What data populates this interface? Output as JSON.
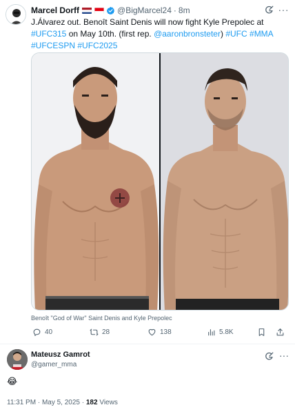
{
  "tweet": {
    "author_name": "Marcel Dorff",
    "handle": "@BigMarcel24",
    "separator": "·",
    "time": "8m",
    "text_parts": [
      {
        "t": "J.Álvarez out. Benoît Saint Denis will now fight Kyle Prepolec at ",
        "link": false
      },
      {
        "t": "#UFC315",
        "link": true
      },
      {
        "t": " on May 10th. (first rep. ",
        "link": false
      },
      {
        "t": "@aaronbronsteter",
        "link": true
      },
      {
        "t": ") ",
        "link": false
      },
      {
        "t": "#UFC",
        "link": true
      },
      {
        "t": " ",
        "link": false
      },
      {
        "t": "#MMA",
        "link": true
      },
      {
        "t": " ",
        "link": false
      },
      {
        "t": "#UFCESPN",
        "link": true
      },
      {
        "t": " ",
        "link": false
      },
      {
        "t": "#UFC2025",
        "link": true
      }
    ],
    "media_caption": "Benoît \"God of War\" Saint Denis and Kyle Prepolec",
    "actions": {
      "replies": "40",
      "reposts": "28",
      "likes": "138",
      "views": "5.8K"
    }
  },
  "reply": {
    "author_name": "Mateusz Gamrot",
    "handle": "@gamer_mma",
    "emoji": "😂",
    "timestamp": "11:31 PM · May 5, 2025 · ",
    "views_count": "182",
    "views_label": " Views"
  },
  "colors": {
    "link": "#1d9bf0",
    "muted": "#536471",
    "verified": "#1d9bf0"
  }
}
